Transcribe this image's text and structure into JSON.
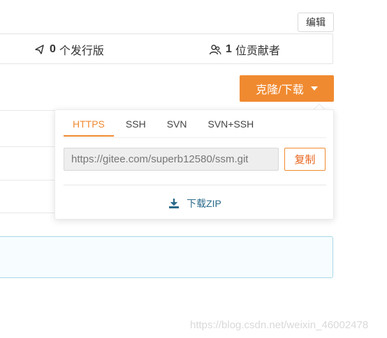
{
  "header": {
    "edit_label": "编辑"
  },
  "stats": {
    "releases_count": "0",
    "releases_label": "个发行版",
    "contributors_count": "1",
    "contributors_label": "位贡献者"
  },
  "clone": {
    "button_label": "克隆/下载"
  },
  "popover": {
    "tabs": [
      {
        "label": "HTTPS",
        "active": true
      },
      {
        "label": "SSH",
        "active": false
      },
      {
        "label": "SVN",
        "active": false
      },
      {
        "label": "SVN+SSH",
        "active": false
      }
    ],
    "url_value": "https://gitee.com/superb12580/ssm.git",
    "copy_label": "复制",
    "download_zip_label": "下载ZIP"
  },
  "watermark": "https://blog.csdn.net/weixin_46002478",
  "colors": {
    "accent": "#f08a30",
    "link": "#2a6a8a",
    "info_border": "#a8d8e8"
  }
}
